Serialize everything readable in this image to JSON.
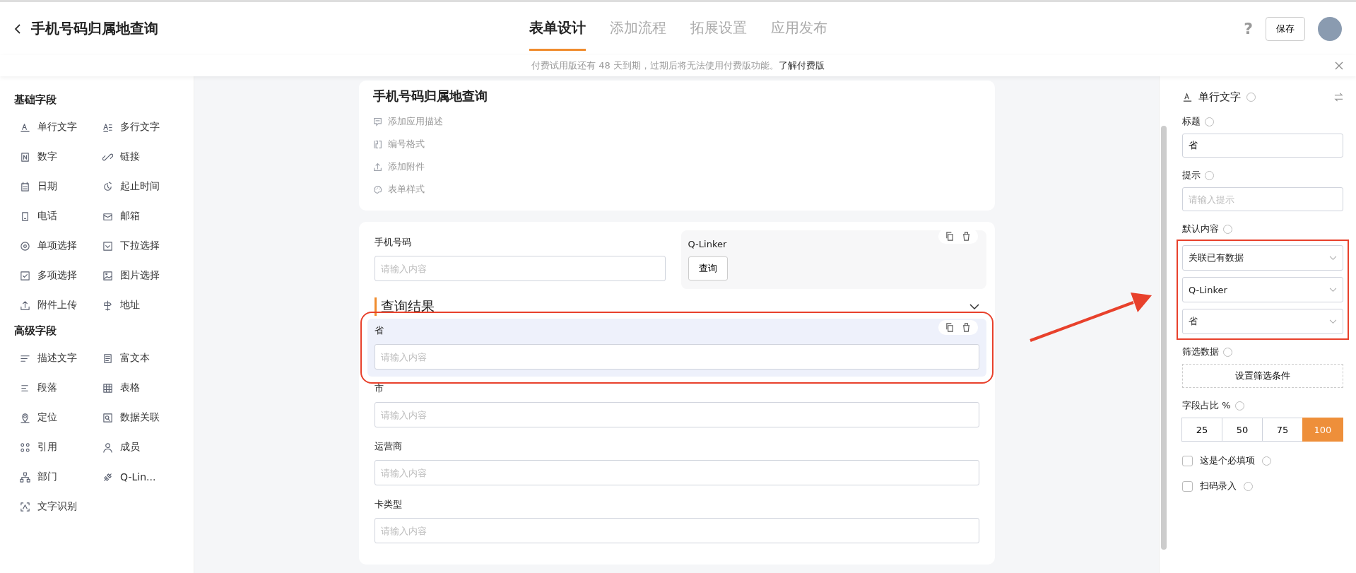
{
  "header": {
    "title": "手机号码归属地查询",
    "tabs": [
      {
        "label": "表单设计",
        "selected": true
      },
      {
        "label": "添加流程",
        "selected": false
      },
      {
        "label": "拓展设置",
        "selected": false
      },
      {
        "label": "应用发布",
        "selected": false
      }
    ],
    "help": "?",
    "save": "保存"
  },
  "notice": {
    "text": "付费试用版还有 48 天到期，过期后将无法使用付费版功能。",
    "link": "了解付费版"
  },
  "sidebar": [
    {
      "title": "基础字段",
      "items": [
        {
          "label": "单行文字",
          "kind": "text"
        },
        {
          "label": "多行文字",
          "kind": "textarea"
        },
        {
          "label": "数字",
          "kind": "number"
        },
        {
          "label": "链接",
          "kind": "link"
        },
        {
          "label": "日期",
          "kind": "date"
        },
        {
          "label": "起止时间",
          "kind": "range"
        },
        {
          "label": "电话",
          "kind": "phone"
        },
        {
          "label": "邮箱",
          "kind": "mail"
        },
        {
          "label": "单项选择",
          "kind": "radio"
        },
        {
          "label": "下拉选择",
          "kind": "dropdown"
        },
        {
          "label": "多项选择",
          "kind": "checkbox"
        },
        {
          "label": "图片选择",
          "kind": "image"
        },
        {
          "label": "附件上传",
          "kind": "upload"
        },
        {
          "label": "地址",
          "kind": "address"
        }
      ]
    },
    {
      "title": "高级字段",
      "items": [
        {
          "label": "描述文字",
          "kind": "desc"
        },
        {
          "label": "富文本",
          "kind": "richtext"
        },
        {
          "label": "段落",
          "kind": "paragraph"
        },
        {
          "label": "表格",
          "kind": "table"
        },
        {
          "label": "定位",
          "kind": "location"
        },
        {
          "label": "数据关联",
          "kind": "relation"
        },
        {
          "label": "引用",
          "kind": "reference"
        },
        {
          "label": "成员",
          "kind": "member"
        },
        {
          "label": "部门",
          "kind": "department"
        },
        {
          "label": "Q-Lin...",
          "kind": "plugin"
        },
        {
          "label": "文字识别",
          "kind": "ocr"
        }
      ]
    }
  ],
  "form": {
    "title": "手机号码归属地查询",
    "options": [
      {
        "label": "添加应用描述",
        "kind": "description"
      },
      {
        "label": "编号格式",
        "kind": "numbering"
      },
      {
        "label": "添加附件",
        "kind": "attachment"
      },
      {
        "label": "表单样式",
        "kind": "style"
      }
    ],
    "phone": {
      "label": "手机号码",
      "placeholder": "请输入内容"
    },
    "plugin": {
      "label": "Q-Linker",
      "button": "查询"
    },
    "section": {
      "title": "查询结果",
      "expanded": true
    },
    "fields": [
      {
        "label": "省",
        "placeholder": "请输入内容",
        "selected": true
      },
      {
        "label": "市",
        "placeholder": "请输入内容",
        "selected": false
      },
      {
        "label": "运营商",
        "placeholder": "请输入内容",
        "selected": false
      },
      {
        "label": "卡类型",
        "placeholder": "请输入内容",
        "selected": false
      }
    ]
  },
  "panel": {
    "type": "单行文字",
    "title_label": "标题",
    "title_value": "省",
    "hint_label": "提示",
    "hint_placeholder": "请输入提示",
    "default_label": "默认内容",
    "default_selects": [
      "关联已有数据",
      "Q-Linker",
      "省"
    ],
    "filter_label": "筛选数据",
    "filter_button": "设置筛选条件",
    "width_label": "字段占比 %",
    "widths": [
      {
        "label": "25",
        "selected": false
      },
      {
        "label": "50",
        "selected": false
      },
      {
        "label": "75",
        "selected": false
      },
      {
        "label": "100",
        "selected": true
      }
    ],
    "checkboxes": [
      {
        "label": "这是个必填项",
        "checked": false
      },
      {
        "label": "扫码录入",
        "checked": false
      }
    ]
  }
}
